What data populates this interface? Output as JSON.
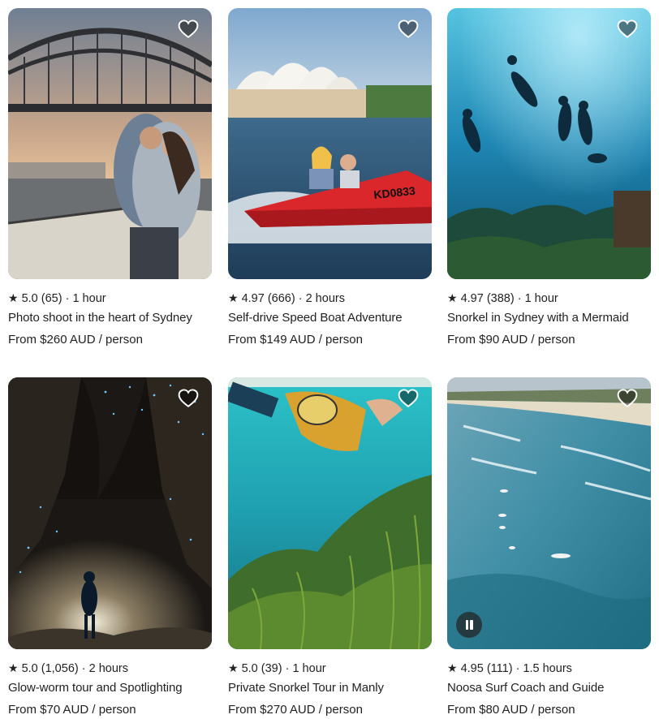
{
  "experiences": [
    {
      "rating": "5.0",
      "reviews": "(65)",
      "duration": "1 hour",
      "title": "Photo shoot in the heart of Sydney",
      "price": "From $260 AUD / person",
      "image": "sydney-harbour-bridge-couple"
    },
    {
      "rating": "4.97",
      "reviews": "(666)",
      "duration": "2 hours",
      "title": "Self-drive Speed Boat Adventure",
      "price": "From $149 AUD / person",
      "image": "opera-house-speed-boat"
    },
    {
      "rating": "4.97",
      "reviews": "(388)",
      "duration": "1 hour",
      "title": "Snorkel in Sydney with a Mermaid",
      "price": "From $90 AUD / person",
      "image": "underwater-snorkelers"
    },
    {
      "rating": "5.0",
      "reviews": "(1,056)",
      "duration": "2 hours",
      "title": "Glow-worm tour and Spotlighting",
      "price": "From $70 AUD / person",
      "image": "glow-worm-cave"
    },
    {
      "rating": "5.0",
      "reviews": "(39)",
      "duration": "1 hour",
      "title": "Private Snorkel Tour in Manly",
      "price": "From $270 AUD / person",
      "image": "snorkeler-over-seaweed"
    },
    {
      "rating": "4.95",
      "reviews": "(111)",
      "duration": "1.5 hours",
      "title": "Noosa Surf Coach and Guide",
      "price": "From $80 AUD / person",
      "image": "aerial-surf-beach"
    }
  ],
  "separator": "·",
  "star_icon": "star-icon",
  "favorite_icon": "heart-outline-icon",
  "video_control_icon": "pause-icon"
}
